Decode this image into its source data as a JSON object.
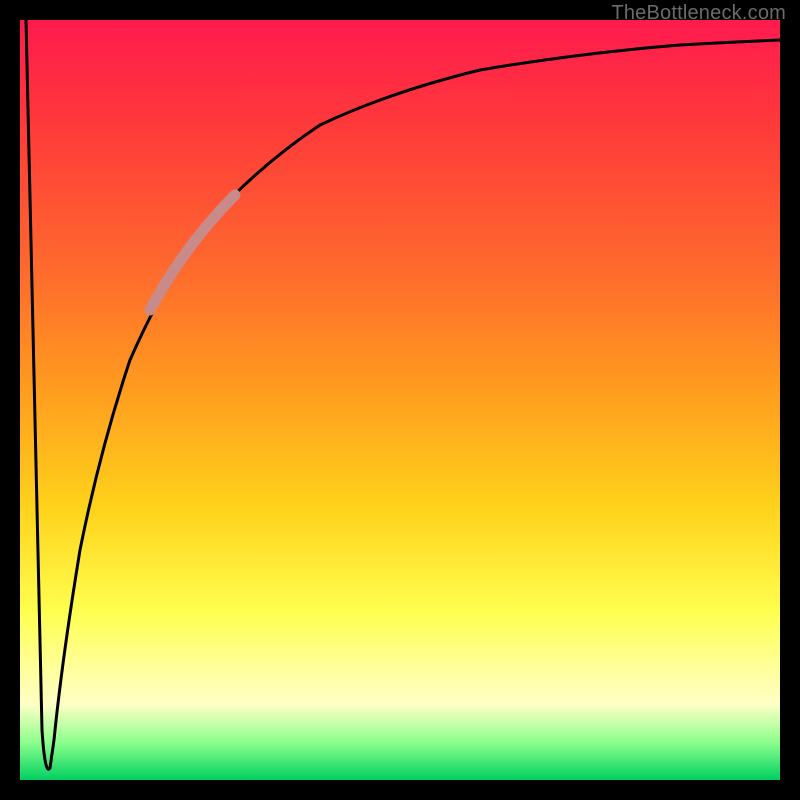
{
  "watermark": "TheBottleneck.com",
  "colors": {
    "frame": "#000000",
    "curve_stroke": "#000000",
    "highlight_stroke": "#c98a8a",
    "gradient_stops": [
      "#ff1a4e",
      "#ff3a3a",
      "#ff6a2d",
      "#ff9a1f",
      "#ffd21a",
      "#ffff50",
      "#ffff99",
      "#ffffc5",
      "#8eff8e",
      "#00d060"
    ]
  },
  "chart_data": {
    "type": "line",
    "title": "",
    "xlabel": "",
    "ylabel": "",
    "xlim": [
      0,
      100
    ],
    "ylim": [
      0,
      100
    ],
    "series": [
      {
        "name": "curve",
        "x": [
          0,
          2,
          3,
          4,
          5,
          6,
          8,
          10,
          13,
          17,
          22,
          28,
          35,
          45,
          60,
          80,
          100
        ],
        "values": [
          100,
          50,
          10,
          2,
          2,
          15,
          35,
          50,
          62,
          72,
          80,
          86,
          90,
          93,
          95,
          96,
          97
        ]
      }
    ],
    "highlight_segment": {
      "x_start": 17,
      "x_end": 28
    },
    "grid": false,
    "legend": false
  }
}
